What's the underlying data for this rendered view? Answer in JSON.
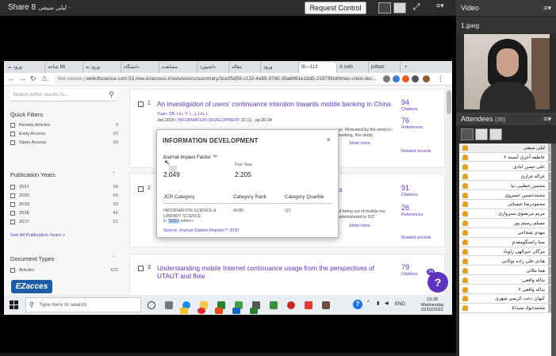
{
  "topbar": {
    "title": "Share 8",
    "subtitle": "لیلی سیفی -",
    "request_control": "Request Control"
  },
  "browser": {
    "tabs": [
      "ورود به",
      "شاخه Mt",
      "ورود به",
      "دانشگاه",
      "مشاهده",
      "داشبورد",
      "مقاله",
      "ورود",
      "I8—113",
      "A noth",
      "pdfam"
    ],
    "url_prefix": "Not secure",
    "url": "webofscience.com.53.new.ezaccess.ir/wos/woscc/summary/3ce35d59-c132-4a99-9780-35a8991e1bd5-21979fdd/times-cited-des..."
  },
  "sidebar": {
    "search_placeholder": "Search within results fo...",
    "quick_filters": "Quick Filters",
    "filters": [
      {
        "label": "Review Articles",
        "count": "9"
      },
      {
        "label": "Early Access",
        "count": "93"
      },
      {
        "label": "Open Access",
        "count": "98"
      }
    ],
    "pub_years": "Publication Years",
    "years": [
      {
        "label": "2021",
        "count": "98"
      },
      {
        "label": "2020",
        "count": "66"
      },
      {
        "label": "2019",
        "count": "93"
      },
      {
        "label": "2018",
        "count": "46"
      },
      {
        "label": "2017",
        "count": "51"
      }
    ],
    "see_all": "See All Publication Years >",
    "doc_types": "Document Types",
    "doc_row": {
      "label": "Articles",
      "count": "622"
    }
  },
  "results": [
    {
      "num": "1",
      "title": "An investigation of users' continuance intention towards mobile banking in China",
      "authors": "Yuan, SB; Liu, Y; (...); Liu, L",
      "date": "Jan 2016",
      "journal": "INFORMATION DEVELOPMENT",
      "pages": "32 (1) , pp.20-34",
      "citations": "94",
      "citations_lbl": "Citations",
      "references": "76",
      "references_lbl": "References",
      "abstract": "ge. Motivated by the need m-banking, this study",
      "show_more": "Show more",
      "related": "Related records"
    },
    {
      "num": "2",
      "title_fragment": "ents",
      "citations": "91",
      "citations_lbl": "Citations",
      "references": "26",
      "references_lbl": "References",
      "abstract": "of being out of mobile res administered to 537",
      "show_more": "Show more",
      "related": "Related records"
    },
    {
      "num": "3",
      "title": "Understanding mobile Internet continuance usage from the perspectives of UTAUT and flow",
      "citations": "79",
      "citations_lbl": "Citations"
    }
  ],
  "popup": {
    "heading": "INFORMATION DEVELOPMENT",
    "close": "×",
    "jif_label": "Journal Impact Factor ™",
    "jif_value": "2.049",
    "five_year_label": "Five Year",
    "five_year_value": "2.205",
    "col_category": "JCR Category",
    "col_rank": "Category Rank",
    "col_quartile": "Category Quartile",
    "row_category_1": "INFORMATION SCIENCE &",
    "row_category_2": "LIBRARY SCIENCE",
    "row_edition_pre": "in",
    "row_edition_hl": "SSCI",
    "row_edition_post": "edition",
    "row_rank": "46/85",
    "row_quartile": "Q3",
    "source": "Source: Journal Citation Reports™ 2020"
  },
  "help": {
    "label": "?",
    "badge": "34"
  },
  "ezaccess": "EZacces",
  "taskbar": {
    "search": "Type here to search",
    "lang": "ENG",
    "time": "13:38",
    "day": "Wednesday",
    "date": "02/02/2022"
  },
  "right": {
    "video_title": "Video",
    "video_file": "1.jpeg",
    "attendees_title": "Attendees",
    "attendees_count": "(35)",
    "attendees": [
      "لیلی سیفی",
      "عاطفه آچری آبسته ۲",
      "علی حسن ابادی",
      "غزاله غزازی",
      "محسن خطیبی نیا",
      "محمدحسین خسروی",
      "محمودرضا عیسائی",
      "مریم مرتضوی سبزواری",
      "مسلم رستم پور",
      "مهدی شجاعی",
      "مینا راستگومقدم",
      "مژگان خیرالهی زاویاد",
      "هادی علی زاده نوکابی",
      "هما ملائی",
      "یداله واقعی",
      "یداله واقعی ۲",
      "کیهان دخت کریمی شهری",
      "محمدجواد سیدابا"
    ]
  }
}
